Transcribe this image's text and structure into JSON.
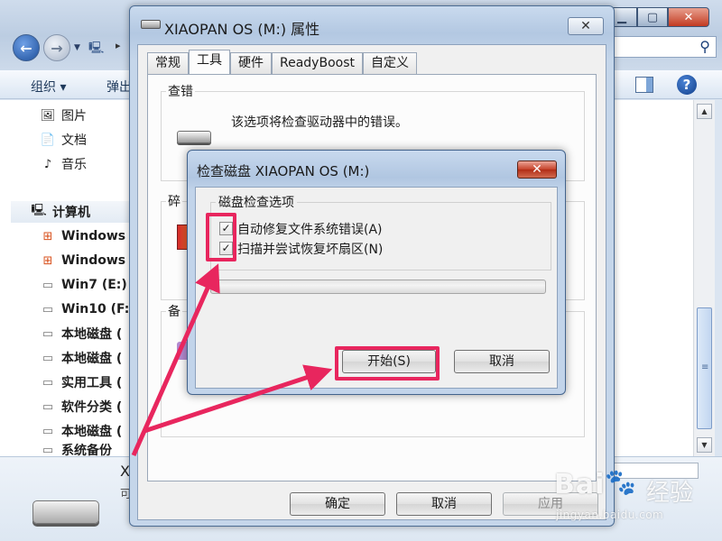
{
  "explorer": {
    "toolbar": {
      "organize": "组织 ▾",
      "eject": "弹出"
    },
    "nav": {
      "pictures": "图片",
      "documents": "文档",
      "music": "音乐",
      "computer": "计算机",
      "drives": [
        "Windows",
        "Windows",
        "Win7 (E:)",
        "Win10 (F:",
        "本地磁盘 (",
        "本地磁盘 (",
        "实用工具 (",
        "软件分类 (",
        "本地磁盘 (",
        "系统备份"
      ]
    },
    "details": {
      "name": "X",
      "sub": "可"
    }
  },
  "props": {
    "title": "XIAOPAN OS (M:) 属性",
    "tabs": [
      "常规",
      "工具",
      "硬件",
      "ReadyBoost",
      "自定义"
    ],
    "active_tab": "工具",
    "error_check": {
      "title": "查错",
      "desc": "该选项将检查驱动器中的错误。"
    },
    "defrag": {
      "title": "碎"
    },
    "backup": {
      "title": "备"
    },
    "buttons": {
      "ok": "确定",
      "cancel": "取消",
      "apply": "应用"
    }
  },
  "check_disk": {
    "title": "检查磁盘 XIAOPAN OS (M:)",
    "group": "磁盘检查选项",
    "options": [
      {
        "label": "自动修复文件系统错误(A)",
        "checked": true
      },
      {
        "label": "扫描并尝试恢复坏扇区(N)",
        "checked": true
      }
    ],
    "start": "开始(S)",
    "cancel": "取消"
  },
  "watermark": {
    "logo": "Bai",
    "brand": "经验",
    "url": "jingyan.baidu.com"
  },
  "colors": {
    "highlight": "#e8265e",
    "accent": "#1d4f9b"
  }
}
